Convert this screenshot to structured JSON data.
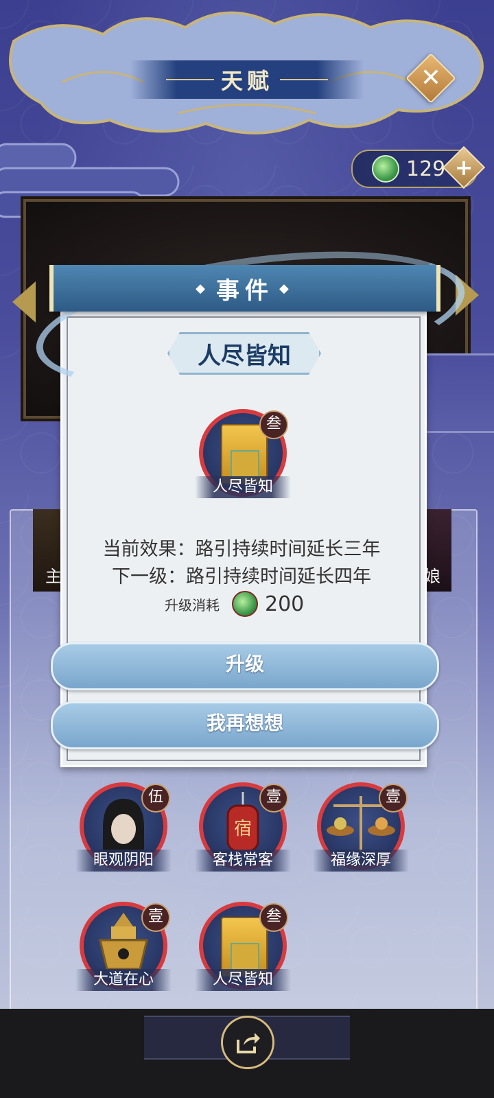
{
  "header": {
    "title": "天赋",
    "close_icon": "close-icon"
  },
  "currency": {
    "icon": "jade-coin-icon",
    "amount": "129",
    "add_icon": "plus-icon"
  },
  "behind": {
    "left_card_char": "主",
    "right_card_char": "娘"
  },
  "modal": {
    "header": "事件",
    "item_name": "人尽皆知",
    "icon": {
      "name": "seal-tablet-icon",
      "level": "叁",
      "label": "人尽皆知"
    },
    "current_effect": "当前效果：路引持续时间延长三年",
    "next_effect": "下一级：路引持续时间延长四年",
    "cost_label": "升级消耗",
    "cost_icon": "jade-coin-icon",
    "cost_value": "200",
    "upgrade_button": "升级",
    "cancel_button": "我再想想"
  },
  "talents": [
    {
      "icon": "hooded-figure-icon",
      "level": "伍",
      "label": "眼观阴阳"
    },
    {
      "icon": "inn-lantern-icon",
      "level": "壹",
      "label": "客栈常客"
    },
    {
      "icon": "scale-icon",
      "level": "壹",
      "label": "福缘深厚"
    },
    {
      "icon": "incense-burner-icon",
      "level": "壹",
      "label": "大道在心"
    },
    {
      "icon": "seal-tablet-icon",
      "level": "叁",
      "label": "人尽皆知"
    }
  ],
  "bottom": {
    "share_icon": "share-icon"
  },
  "colors": {
    "accent_red": "#d83b3f",
    "header_blue": "#2d5a85",
    "gold": "#d6bb7e"
  }
}
